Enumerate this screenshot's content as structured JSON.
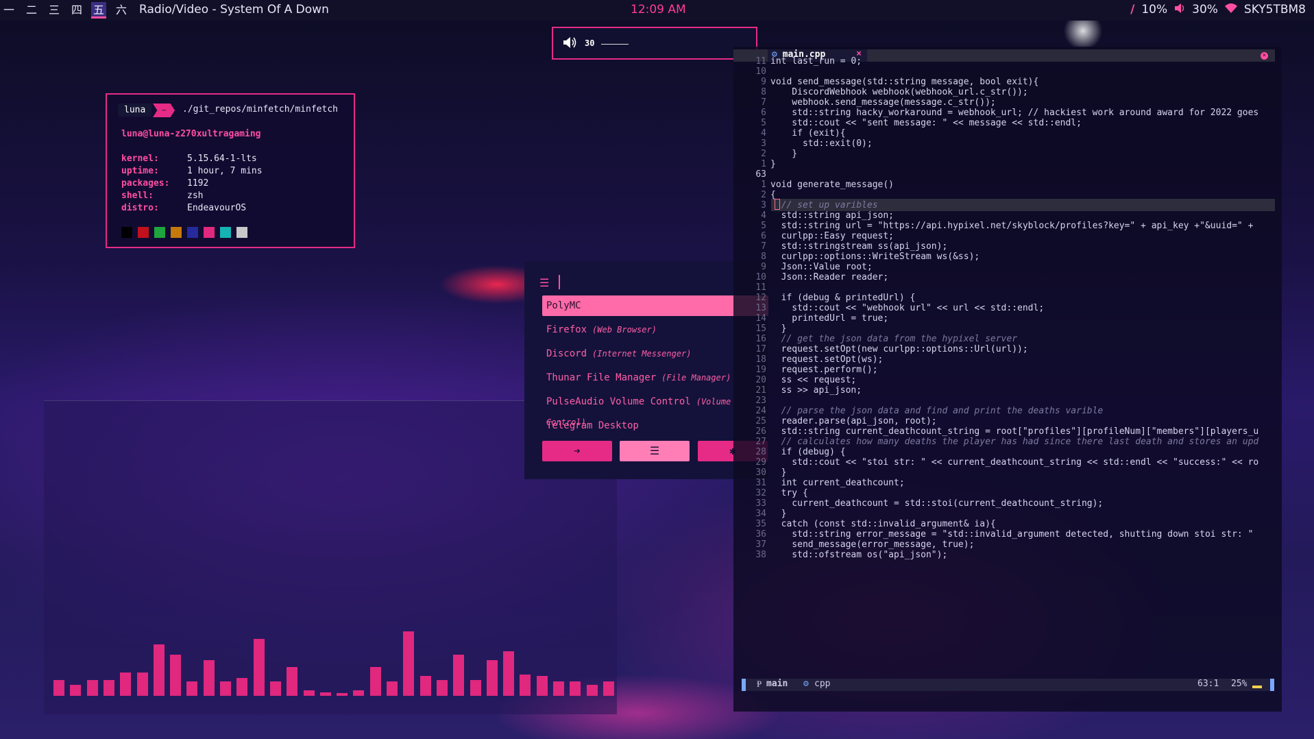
{
  "topbar": {
    "workspaces": [
      "一",
      "二",
      "三",
      "四",
      "五",
      "六"
    ],
    "active_workspace": "五",
    "title": "Radio/Video - System Of A Down",
    "clock": "12:09 AM",
    "cpu": "10%",
    "volume": "30%",
    "network": "SKY5TBM8"
  },
  "volume_popup": {
    "level": "30"
  },
  "fetch": {
    "prompt_name": "luna",
    "prompt_dir": "~",
    "command": "./git_repos/minfetch/minfetch",
    "userhost": "luna@luna-z270xultragaming",
    "rows": [
      {
        "label": "kernel:",
        "value": "5.15.64-1-lts"
      },
      {
        "label": "uptime:",
        "value": "1 hour, 7 mins"
      },
      {
        "label": "packages:",
        "value": "1192"
      },
      {
        "label": "shell:",
        "value": "zsh"
      },
      {
        "label": "distro:",
        "value": "EndeavourOS"
      }
    ],
    "swatches": [
      "#000000",
      "#c3101d",
      "#1fa53d",
      "#c5790c",
      "#252a9c",
      "#e0287e",
      "#15b3b3",
      "#c8c8c8"
    ]
  },
  "launcher": {
    "items": [
      {
        "name": "PolyMC",
        "desc": ""
      },
      {
        "name": "Firefox",
        "desc": "(Web Browser)"
      },
      {
        "name": "Discord",
        "desc": "(Internet Messenger)"
      },
      {
        "name": "Thunar File Manager",
        "desc": "(File Manager)"
      },
      {
        "name": "PulseAudio Volume Control",
        "desc": "(Volume Control)"
      },
      {
        "name": "Telegram Desktop",
        "desc": ""
      }
    ],
    "buttons": [
      "➔",
      "☰",
      "✱"
    ]
  },
  "editor": {
    "tab_name": "main.cpp",
    "code_lines": [
      {
        "num": "11",
        "text": "int last_run = 0;"
      },
      {
        "num": "10",
        "text": ""
      },
      {
        "num": "9",
        "text": "void send_message(std::string message, bool exit){"
      },
      {
        "num": "8",
        "text": "    DiscordWebhook webhook(webhook_url.c_str());"
      },
      {
        "num": "7",
        "text": "    webhook.send_message(message.c_str());"
      },
      {
        "num": "6",
        "text": "    std::string hacky_workaround = webhook_url; // hackiest work around award for 2022 goes"
      },
      {
        "num": "5",
        "text": "    std::cout << \"sent message: \" << message << std::endl;"
      },
      {
        "num": "4",
        "text": "    if (exit){"
      },
      {
        "num": "3",
        "text": "      std::exit(0);"
      },
      {
        "num": "2",
        "text": "    }"
      },
      {
        "num": "1",
        "text": "}"
      },
      {
        "num": "63",
        "text": ""
      },
      {
        "num": "1",
        "text": "void generate_message()"
      },
      {
        "num": "2",
        "text": "{"
      },
      {
        "num": "3",
        "text": "  // set up varibles"
      },
      {
        "num": "4",
        "text": "  std::string api_json;"
      },
      {
        "num": "5",
        "text": "  std::string url = \"https://api.hypixel.net/skyblock/profiles?key=\" + api_key +\"&uuid=\" +"
      },
      {
        "num": "6",
        "text": "  curlpp::Easy request;"
      },
      {
        "num": "7",
        "text": "  std::stringstream ss(api_json);"
      },
      {
        "num": "8",
        "text": "  curlpp::options::WriteStream ws(&ss);"
      },
      {
        "num": "9",
        "text": "  Json::Value root;"
      },
      {
        "num": "10",
        "text": "  Json::Reader reader;"
      },
      {
        "num": "11",
        "text": ""
      },
      {
        "num": "12",
        "text": "  if (debug & printedUrl) {"
      },
      {
        "num": "13",
        "text": "    std::cout << \"webhook url\" << url << std::endl;"
      },
      {
        "num": "14",
        "text": "    printedUrl = true;"
      },
      {
        "num": "15",
        "text": "  }"
      },
      {
        "num": "16",
        "text": "  // get the json data from the hypixel server"
      },
      {
        "num": "17",
        "text": "  request.setOpt(new curlpp::options::Url(url));"
      },
      {
        "num": "18",
        "text": "  request.setOpt(ws);"
      },
      {
        "num": "19",
        "text": "  request.perform();"
      },
      {
        "num": "20",
        "text": "  ss << request;"
      },
      {
        "num": "21",
        "text": "  ss >> api_json;"
      },
      {
        "num": "23",
        "text": ""
      },
      {
        "num": "24",
        "text": "  // parse the json data and find and print the deaths varible"
      },
      {
        "num": "25",
        "text": "  reader.parse(api_json, root);"
      },
      {
        "num": "26",
        "text": "  std::string current_deathcount_string = root[\"profiles\"][profileNum][\"members\"][players_u"
      },
      {
        "num": "27",
        "text": "  // calculates how many deaths the player has had since there last death and stores an upd"
      },
      {
        "num": "28",
        "text": "  if (debug) {"
      },
      {
        "num": "29",
        "text": "    std::cout << \"stoi str: \" << current_deathcount_string << std::endl << \"success:\" << ro"
      },
      {
        "num": "30",
        "text": "  }"
      },
      {
        "num": "31",
        "text": "  int current_deathcount;"
      },
      {
        "num": "32",
        "text": "  try {"
      },
      {
        "num": "33",
        "text": "    current_deathcount = std::stoi(current_deathcount_string);"
      },
      {
        "num": "34",
        "text": "  }"
      },
      {
        "num": "35",
        "text": "  catch (const std::invalid_argument& ia){"
      },
      {
        "num": "36",
        "text": "    std::string error_message = \"std::invalid_argument detected, shutting down stoi str: \""
      },
      {
        "num": "37",
        "text": "    send_message(error_message, true);"
      },
      {
        "num": "38",
        "text": "    std::ofstream os(\"api_json\");"
      }
    ],
    "status": {
      "branch": "main",
      "filetype": "cpp",
      "position": "63:1",
      "percent": "25%"
    }
  },
  "visualizer": {
    "bars": [
      0.09,
      0.06,
      0.09,
      0.09,
      0.13,
      0.13,
      0.29,
      0.23,
      0.08,
      0.2,
      0.08,
      0.1,
      0.32,
      0.08,
      0.16,
      0.03,
      0.02,
      0.01,
      0.03,
      0.16,
      0.08,
      0.36,
      0.11,
      0.09,
      0.23,
      0.09,
      0.2,
      0.25,
      0.12,
      0.11,
      0.08,
      0.08,
      0.06,
      0.08
    ]
  }
}
